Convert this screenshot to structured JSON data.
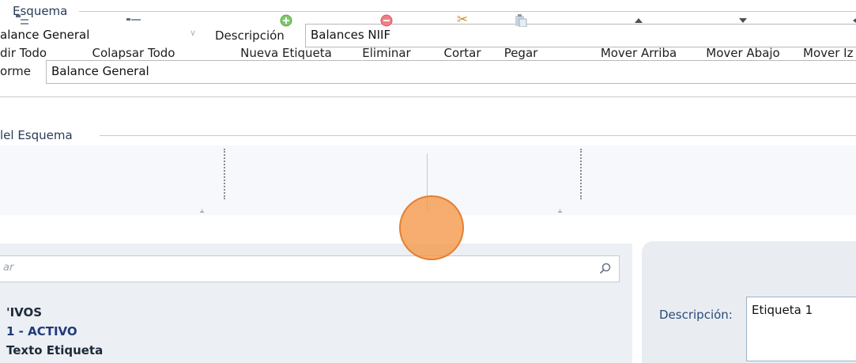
{
  "esquema_group": {
    "legend": "Esquema"
  },
  "esquema_combo": {
    "value": "alance General"
  },
  "descripcion": {
    "label": "Descripción",
    "value": "Balances NIIF"
  },
  "informe": {
    "label": "orme",
    "value": "Balance General"
  },
  "esquema_detail_group": {
    "legend": "lel Esquema"
  },
  "toolbar": {
    "expandir_todo": "dir Todo",
    "colapsar_todo": "Colapsar Todo",
    "nueva_etiqueta": "Nueva Etiqueta",
    "eliminar": "Eliminar",
    "cortar": "Cortar",
    "pegar": "Pegar",
    "mover_arriba": "Mover Arriba",
    "mover_abajo": "Mover Abajo",
    "mover_izquierda": "Mover Iz"
  },
  "search": {
    "placeholder": "ar"
  },
  "tree": {
    "items": [
      "'IVOS",
      "1 - ACTIVO",
      "Texto Etiqueta"
    ]
  },
  "detail": {
    "descripcion_label": "Descripción:",
    "descripcion_value": "Etiqueta 1"
  },
  "colors": {
    "accent_text": "#1f3b7a",
    "toolbar_bg": "#f6f8fb",
    "cursor": "#f5964a"
  }
}
